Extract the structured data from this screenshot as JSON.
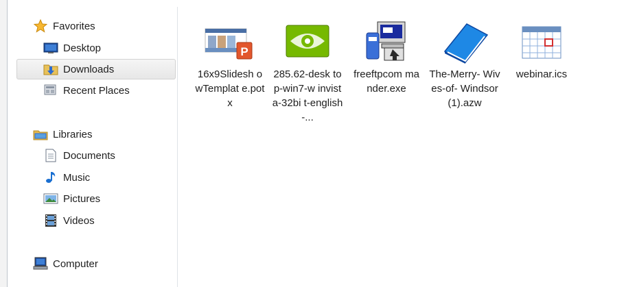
{
  "navigation": {
    "favorites": {
      "label": "Favorites",
      "icon": "star-icon"
    },
    "desktop": {
      "label": "Desktop",
      "icon": "desktop-icon"
    },
    "downloads": {
      "label": "Downloads",
      "icon": "downloads-folder-icon",
      "selected": true
    },
    "recent_places": {
      "label": "Recent Places",
      "icon": "recent-places-icon"
    },
    "libraries": {
      "label": "Libraries",
      "icon": "libraries-icon"
    },
    "documents": {
      "label": "Documents",
      "icon": "documents-icon"
    },
    "music": {
      "label": "Music",
      "icon": "music-icon"
    },
    "pictures": {
      "label": "Pictures",
      "icon": "pictures-icon"
    },
    "videos": {
      "label": "Videos",
      "icon": "videos-icon"
    },
    "computer": {
      "label": "Computer",
      "icon": "computer-icon"
    }
  },
  "files": [
    {
      "name": "16x9SlideshowTemplate.potx",
      "display": "16x9Slidesh owTemplat e.potx",
      "icon": "powerpoint-template-icon"
    },
    {
      "name": "285.62-desktop-win7-winvista-32bit-english-...",
      "display": "285.62-desk top-win7-w invista-32bi t-english-...",
      "icon": "nvidia-installer-icon"
    },
    {
      "name": "freeftpcommander.exe",
      "display": "freeftpcom mander.exe",
      "icon": "ftp-app-icon"
    },
    {
      "name": "The-Merry-Wives-of-Windsor (1).azw",
      "display": "The-Merry- Wives-of- Windsor (1).azw",
      "icon": "ebook-icon"
    },
    {
      "name": "webinar.ics",
      "display": "webinar.ics",
      "icon": "calendar-icon"
    }
  ],
  "colors": {
    "selection_bg": "#e8e8e8",
    "nav_border": "#dfe3e8",
    "text": "#1e1e1e"
  }
}
